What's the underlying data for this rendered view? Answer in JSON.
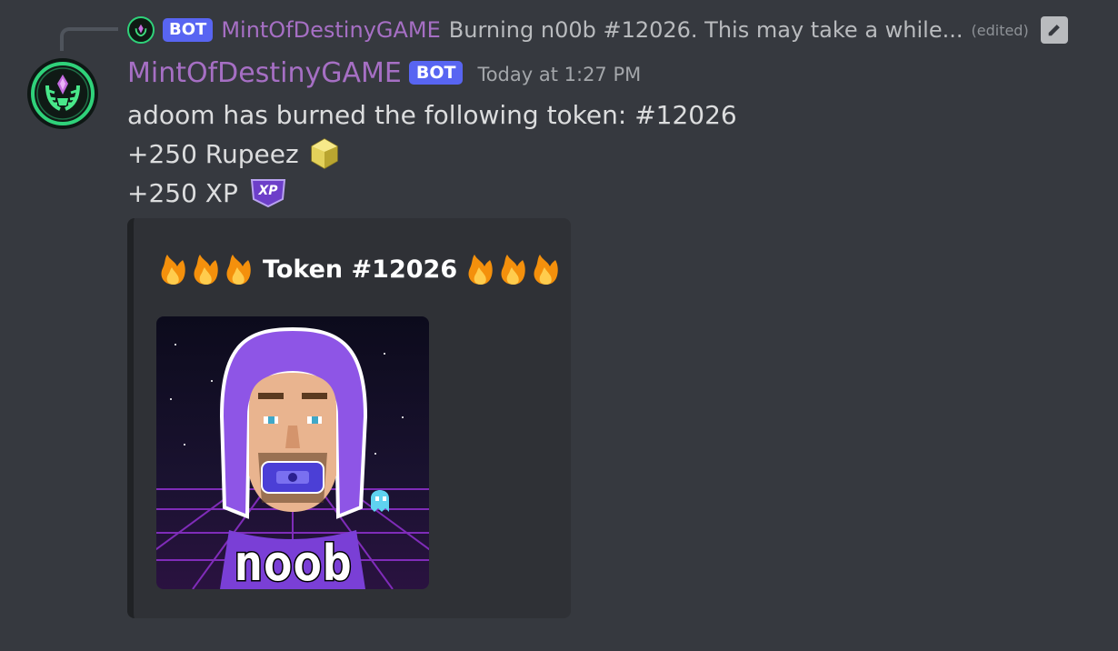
{
  "reply": {
    "author": "MintOfDestinyGAME",
    "bot_tag": "BOT",
    "text": "Burning n00b #12026. This may take a while...",
    "edited": "(edited)"
  },
  "message": {
    "author": "MintOfDestinyGAME",
    "bot_tag": "BOT",
    "timestamp": "Today at 1:27 PM",
    "lines": [
      "adoom has burned the following token: #12026",
      "+250 Rupeez",
      "+250 XP"
    ],
    "xp_badge": "XP"
  },
  "embed": {
    "title": "Token #12026",
    "image_caption": "noob"
  },
  "icons": {
    "avatar": "green-laurel-crest-icon",
    "rupee": "yellow-gem-icon",
    "xp": "xp-badge-icon",
    "flame": "fire-emoji-icon",
    "edit": "pencil-icon"
  },
  "colors": {
    "background": "#36393f",
    "embed_bg": "#2f3136",
    "author": "#a66fc4",
    "bot_tag": "#5865f2"
  }
}
